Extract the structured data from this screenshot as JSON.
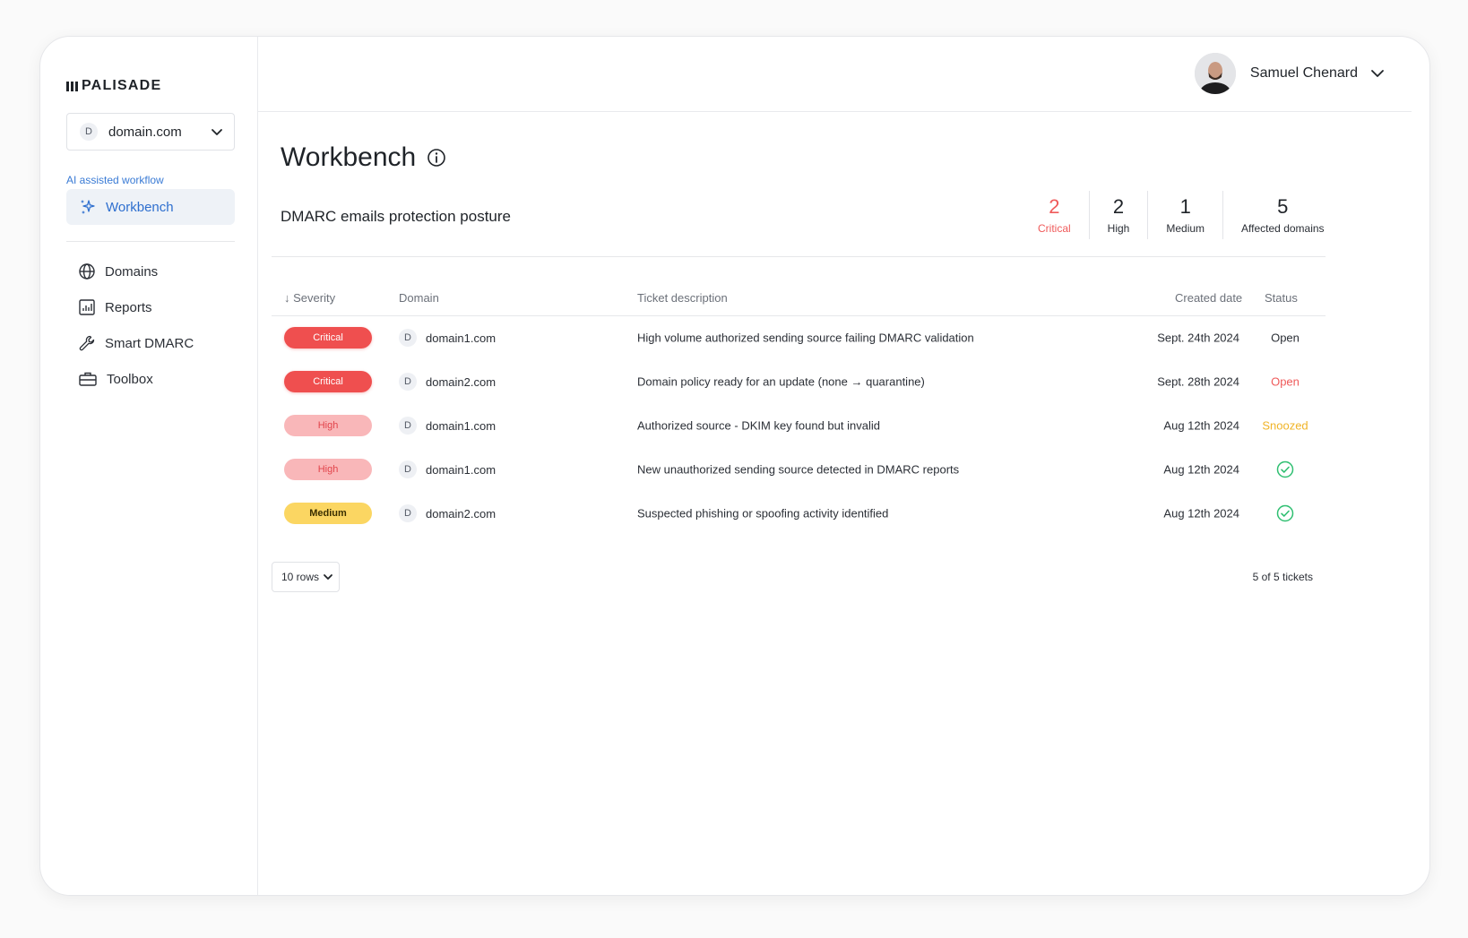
{
  "brand": {
    "name": "PALISADE"
  },
  "sidebar": {
    "domain_selector": {
      "avatar": "D",
      "value": "domain.com"
    },
    "section_label": "AI assisted workflow",
    "active_item": {
      "label": "Workbench",
      "icon": "sparkles-icon"
    },
    "items": [
      {
        "label": "Domains",
        "icon": "globe-icon"
      },
      {
        "label": "Reports",
        "icon": "chart-icon"
      },
      {
        "label": "Smart DMARC",
        "icon": "wrench-icon"
      },
      {
        "label": "Toolbox",
        "icon": "toolbox-icon"
      }
    ]
  },
  "header": {
    "user_name": "Samuel Chenard"
  },
  "page": {
    "title": "Workbench",
    "posture_title": "DMARC emails protection posture"
  },
  "stats": [
    {
      "value": "2",
      "label": "Critical"
    },
    {
      "value": "2",
      "label": "High"
    },
    {
      "value": "1",
      "label": "Medium"
    },
    {
      "value": "5",
      "label": "Affected domains"
    }
  ],
  "table": {
    "columns": {
      "severity": "↓ Severity",
      "domain": "Domain",
      "description": "Ticket description",
      "created": "Created date",
      "status": "Status"
    },
    "rows": [
      {
        "severity": "Critical",
        "domain_avatar": "D",
        "domain": "domain1.com",
        "description": "High volume authorized sending source failing DMARC validation",
        "created": "Sept. 24th 2024",
        "status": "Open"
      },
      {
        "severity": "Critical",
        "domain_avatar": "D",
        "domain": "domain2.com",
        "description": "Domain policy ready for an update (none → quarantine)",
        "created": "Sept. 28th 2024",
        "status": "Open"
      },
      {
        "severity": "High",
        "domain_avatar": "D",
        "domain": "domain1.com",
        "description": "Authorized source - DKIM key found but invalid",
        "created": "Aug 12th 2024",
        "status": "Snoozed"
      },
      {
        "severity": "High",
        "domain_avatar": "D",
        "domain": "domain1.com",
        "description": "New unauthorized sending source detected in DMARC reports",
        "created": "Aug 12th 2024",
        "status": "check-circle-icon"
      },
      {
        "severity": "Medium",
        "domain_avatar": "D",
        "domain": "domain2.com",
        "description": "Suspected phishing or spoofing activity identified",
        "created": "Aug 12th 2024",
        "status": "check-circle-icon"
      }
    ]
  },
  "footer": {
    "rows_select": "10 rows",
    "count": "5 of 5 tickets"
  },
  "colors": {
    "accent": "#2e6fcf",
    "critical": "#ef4f4f",
    "high": "#f9b7b9",
    "medium": "#fbd662",
    "success": "#2fbf71",
    "snoozed": "#f0b428"
  }
}
